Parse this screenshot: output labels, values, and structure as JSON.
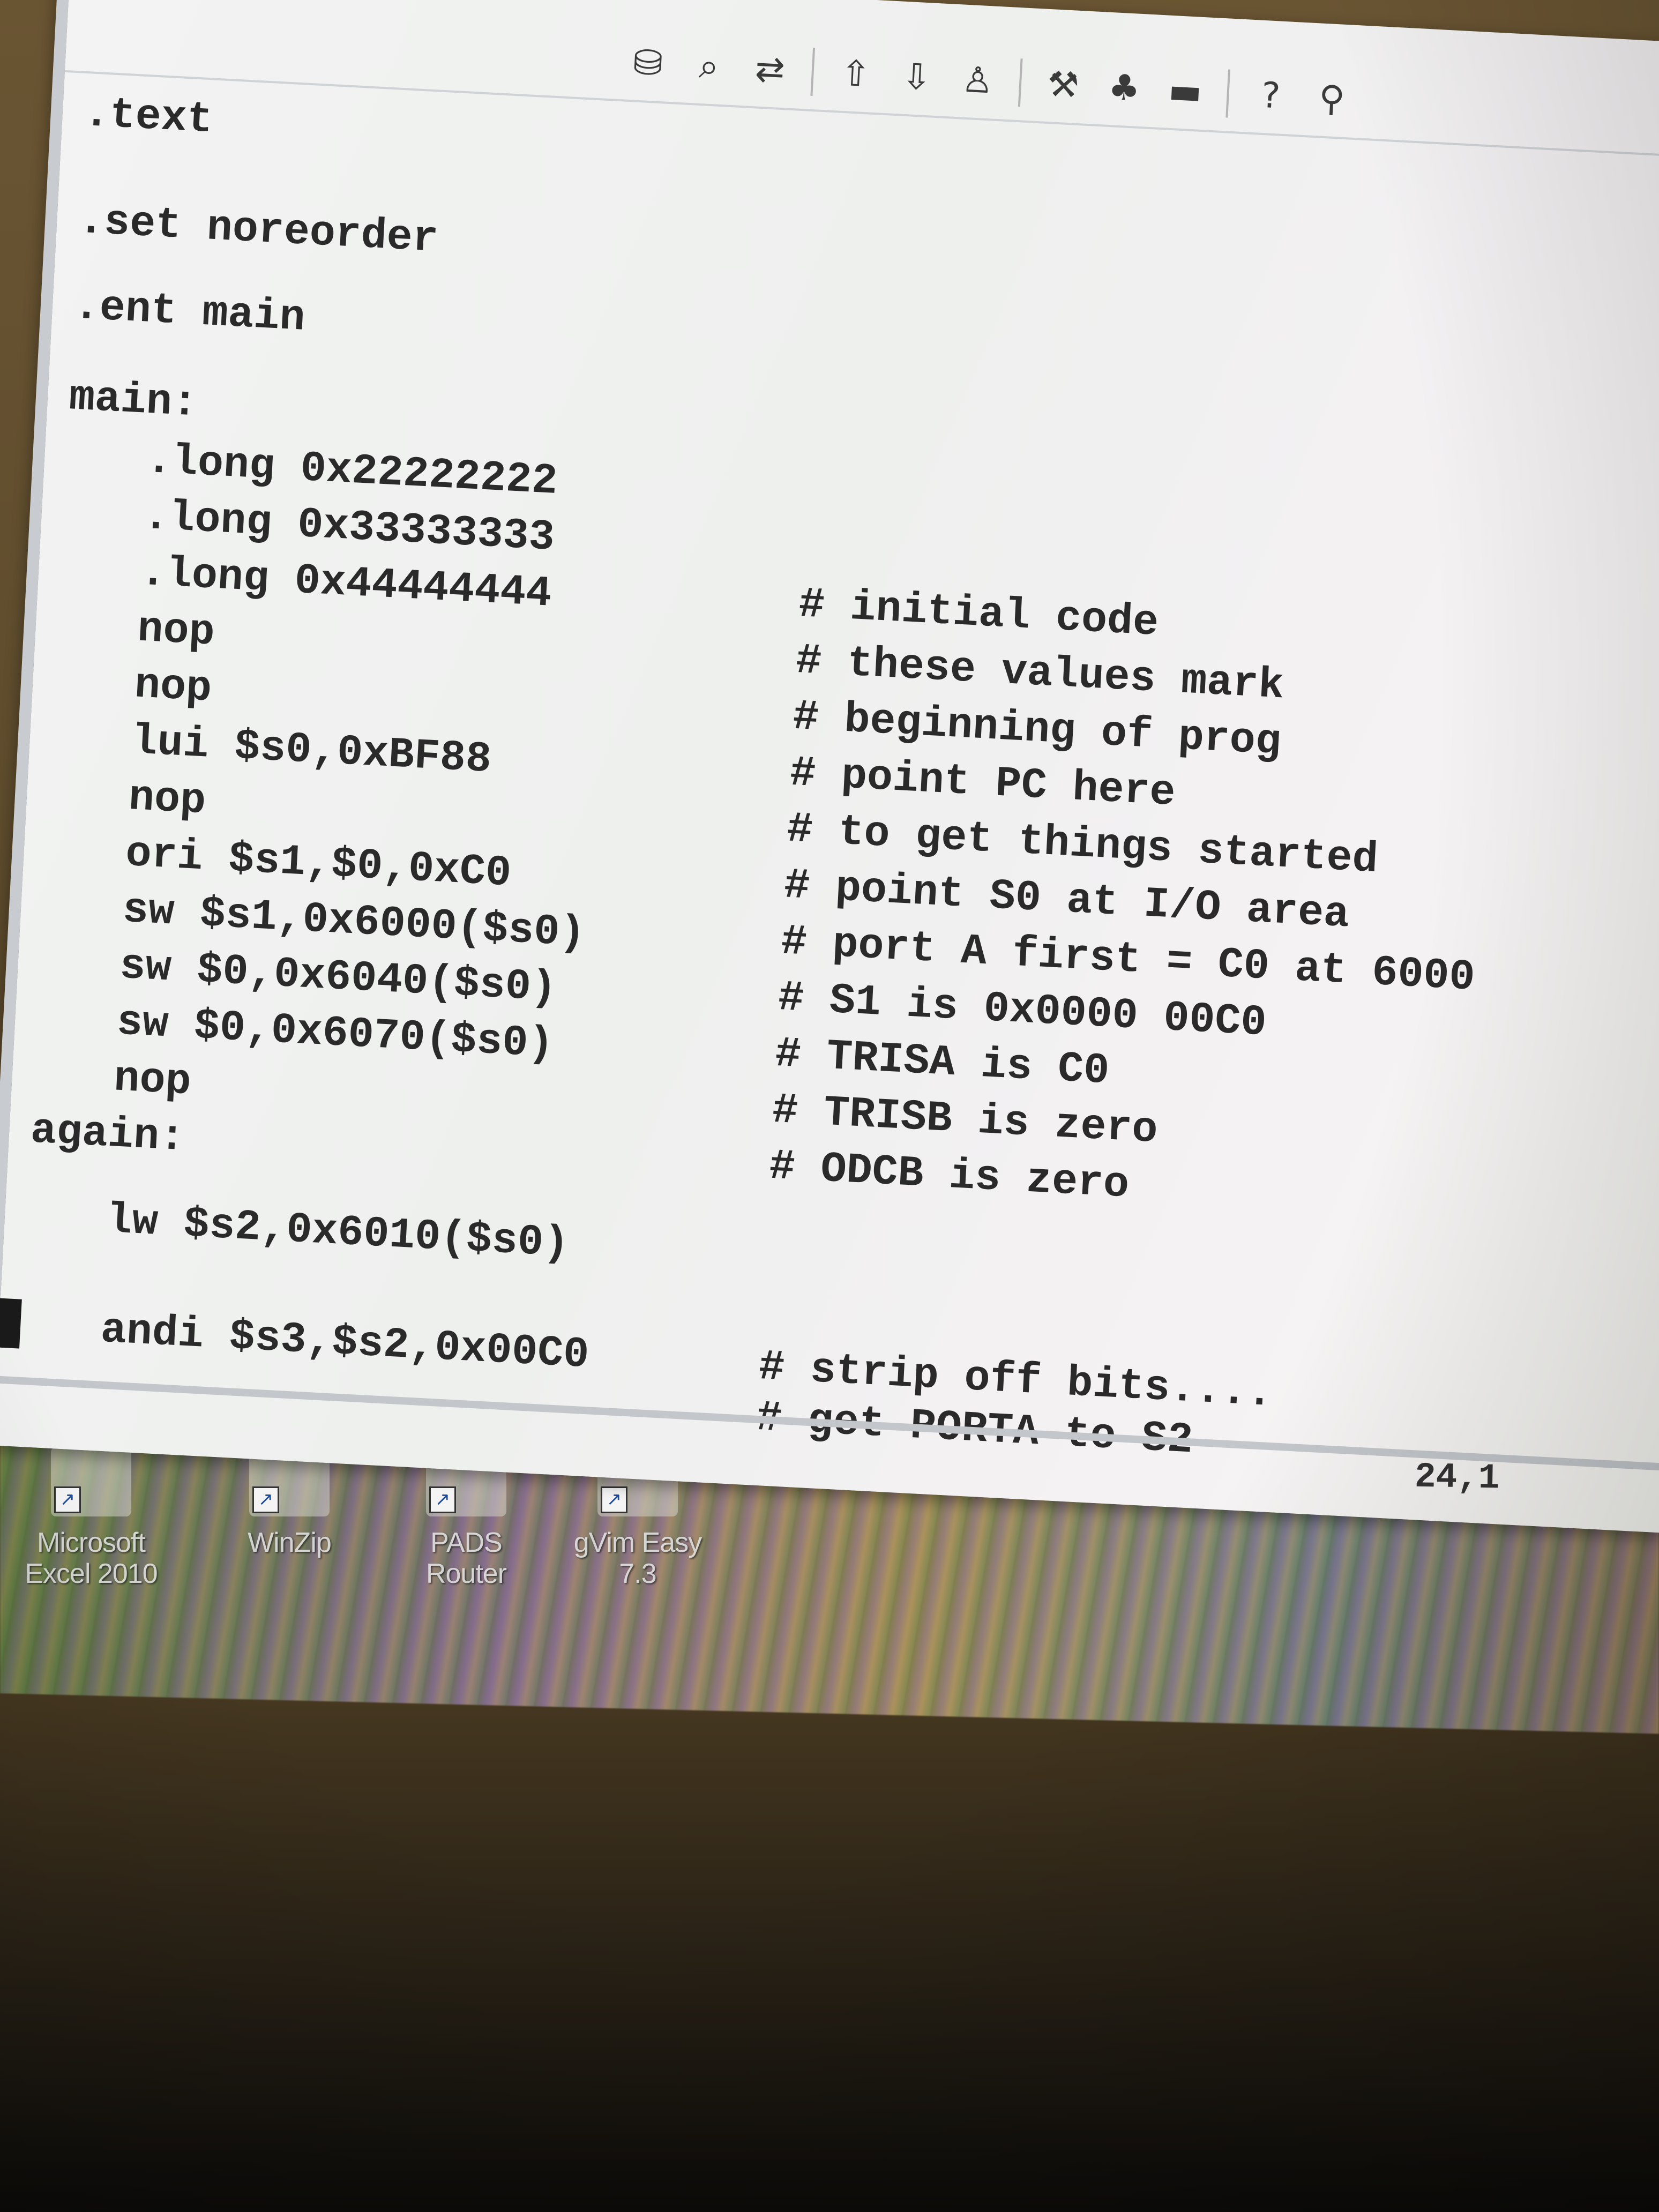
{
  "toolbar": {
    "icons": [
      "save-icon",
      "find-icon",
      "replace-icon",
      "load-session-icon",
      "save-session-icon",
      "run-script-icon",
      "make-icon",
      "ctags-icon",
      "tag-jump-icon",
      "help-icon",
      "help-search-icon"
    ]
  },
  "editor": {
    "lines": [
      {
        "instr": ".text",
        "comment": ""
      },
      {
        "instr": ".set noreorder",
        "comment": ""
      },
      {
        "instr": ".ent main",
        "comment": ""
      },
      {
        "instr": "main:",
        "comment": ""
      },
      {
        "instr": ".long 0x22222222",
        "comment": ""
      },
      {
        "instr": ".long 0x33333333",
        "comment": "# initial code"
      },
      {
        "instr": ".long 0x44444444",
        "comment": "# these values mark"
      },
      {
        "instr": "nop",
        "comment": "# beginning of prog"
      },
      {
        "instr": "nop",
        "comment": "# point PC here"
      },
      {
        "instr": "lui $s0,0xBF88",
        "comment": "# to get things started"
      },
      {
        "instr": "nop",
        "comment": "# point S0 at I/O area"
      },
      {
        "instr": "ori $s1,$0,0xC0",
        "comment": "# port A first = C0 at 6000"
      },
      {
        "instr": "sw $s1,0x6000($s0)",
        "comment": "# S1 is 0x0000 00C0"
      },
      {
        "instr": "sw $0,0x6040($s0)",
        "comment": "# TRISA is C0"
      },
      {
        "instr": "sw $0,0x6070($s0)",
        "comment": "# TRISB is zero"
      },
      {
        "instr": "nop",
        "comment": "# ODCB is zero"
      },
      {
        "instr": "again:",
        "comment": ""
      },
      {
        "instr": "lw $s2,0x6010($s0)",
        "comment": ""
      },
      {
        "instr": "andi $s3,$s2,0x00C0",
        "comment": "# get PORTA to S2"
      },
      {
        "instr": "",
        "comment": "# strip off bits...."
      }
    ]
  },
  "status": {
    "cursor_position": "24,1"
  },
  "desktop": {
    "shortcuts": [
      {
        "label_line1": "Microsoft",
        "label_line2": "Excel 2010",
        "icon": "excel-icon"
      },
      {
        "label_line1": "WinZip",
        "label_line2": "",
        "icon": "winzip-icon"
      },
      {
        "label_line1": "PADS Router",
        "label_line2": "",
        "icon": "pads-router-icon"
      },
      {
        "label_line1": "gVim Easy 7.3",
        "label_line2": "",
        "icon": "gvim-icon"
      }
    ]
  }
}
